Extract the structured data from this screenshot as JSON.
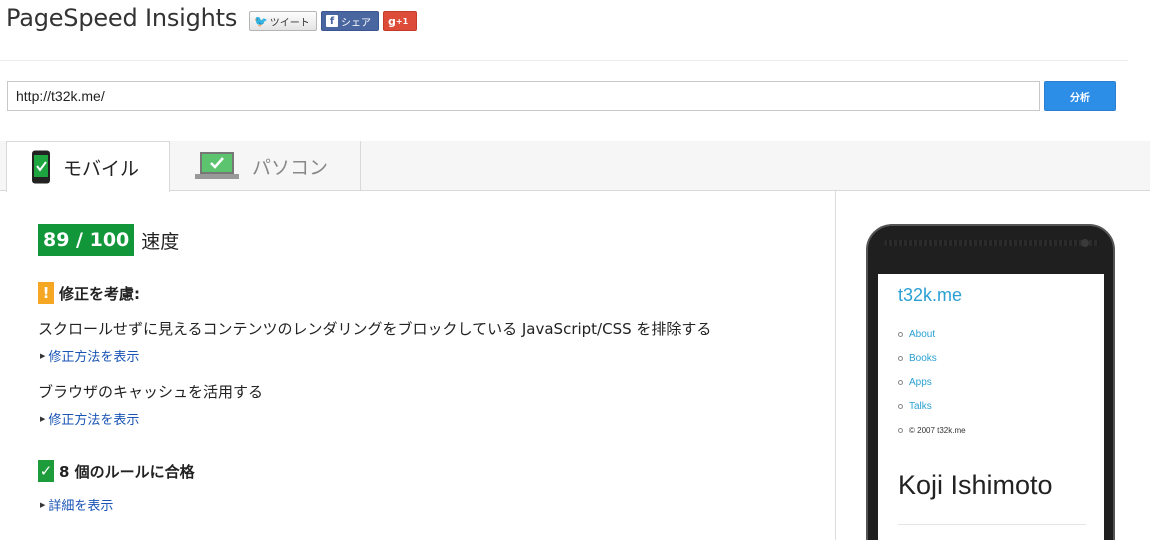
{
  "header": {
    "title": "PageSpeed Insights",
    "social": {
      "tweet": "ツイート",
      "share": "シェア",
      "gplus": "+1"
    }
  },
  "url_bar": {
    "value": "http://t32k.me/",
    "analyze_label": "分析"
  },
  "tabs": [
    {
      "label": "モバイル",
      "active": true
    },
    {
      "label": "パソコン",
      "active": false
    }
  ],
  "results": {
    "score": "89 / 100",
    "score_label": "速度",
    "consider_heading": "修正を考慮:",
    "rules": [
      {
        "text": "スクロールせずに見えるコンテンツのレンダリングをブロックしている JavaScript/CSS を排除する",
        "link": "修正方法を表示"
      },
      {
        "text": "ブラウザのキャッシュを活用する",
        "link": "修正方法を表示"
      }
    ],
    "passed_heading": "8 個のルールに合格",
    "passed_link": "詳細を表示"
  },
  "preview": {
    "site_title": "t32k.me",
    "nav": [
      "About",
      "Books",
      "Apps",
      "Talks"
    ],
    "copyright": "© 2007 t32k.me",
    "name": "Koji Ishimoto"
  },
  "colors": {
    "score_green": "#11973a",
    "warn_orange": "#f5a623",
    "link_blue": "#1a55b5",
    "button_blue": "#2d8ee8"
  }
}
